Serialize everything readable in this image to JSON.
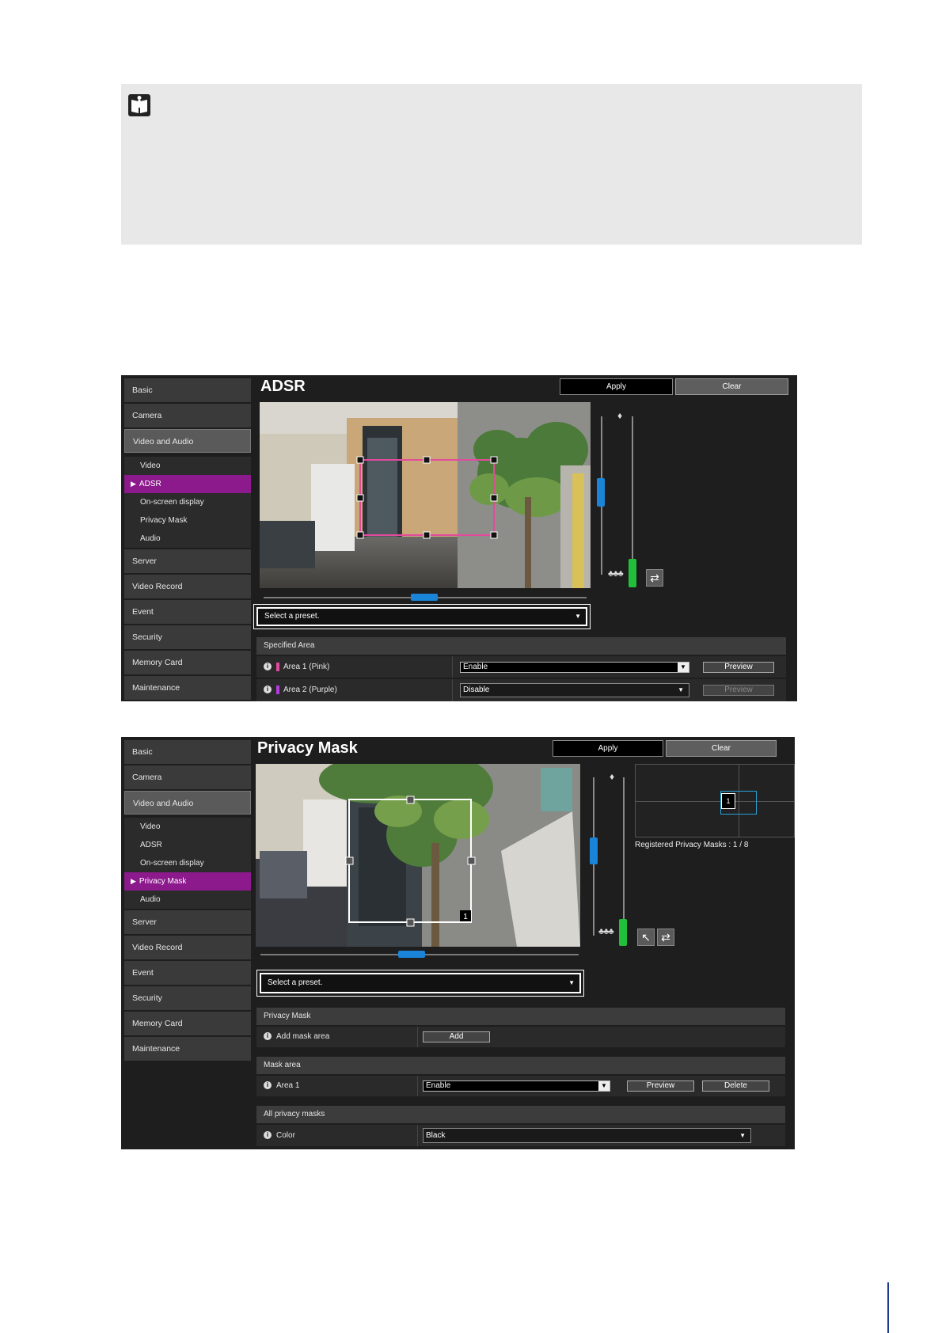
{
  "colors": {
    "accent_purple": "#8c1a8c",
    "slider_blue": "#1a84d8",
    "slider_green": "#22c03a",
    "mask_pink": "#e34a9c",
    "mask_purple": "#b43cdc"
  },
  "note": {
    "icon": "important-book-icon"
  },
  "adsr": {
    "title": "ADSR",
    "apply": "Apply",
    "clear": "Clear",
    "nav": {
      "basic": "Basic",
      "camera": "Camera",
      "video_audio": "Video and Audio",
      "sub": [
        "Video",
        "ADSR",
        "On-screen display",
        "Privacy Mask",
        "Audio"
      ],
      "server": "Server",
      "video_record": "Video Record",
      "event": "Event",
      "security": "Security",
      "memory_card": "Memory Card",
      "maintenance": "Maintenance"
    },
    "preset": "Select a preset.",
    "section": "Specified Area",
    "rows": [
      {
        "label": "Area 1 (Pink)",
        "value": "Enable",
        "button": "Preview"
      },
      {
        "label": "Area 2 (Purple)",
        "value": "Disable",
        "button": "Preview"
      }
    ]
  },
  "privacy": {
    "title": "Privacy Mask",
    "apply": "Apply",
    "clear": "Clear",
    "nav": {
      "basic": "Basic",
      "camera": "Camera",
      "video_audio": "Video and Audio",
      "sub": [
        "Video",
        "ADSR",
        "On-screen display",
        "Privacy Mask",
        "Audio"
      ],
      "server": "Server",
      "video_record": "Video Record",
      "event": "Event",
      "security": "Security",
      "memory_card": "Memory Card",
      "maintenance": "Maintenance"
    },
    "registered": "Registered Privacy Masks : 1 / 8",
    "mask_number": "1",
    "preset": "Select a preset.",
    "sec_privacy": "Privacy Mask",
    "add_label": "Add mask area",
    "add_button": "Add",
    "sec_mask_area": "Mask area",
    "area_label": "Area 1",
    "area_value": "Enable",
    "preview": "Preview",
    "delete": "Delete",
    "sec_all": "All privacy masks",
    "color_label": "Color",
    "color_value": "Black"
  }
}
